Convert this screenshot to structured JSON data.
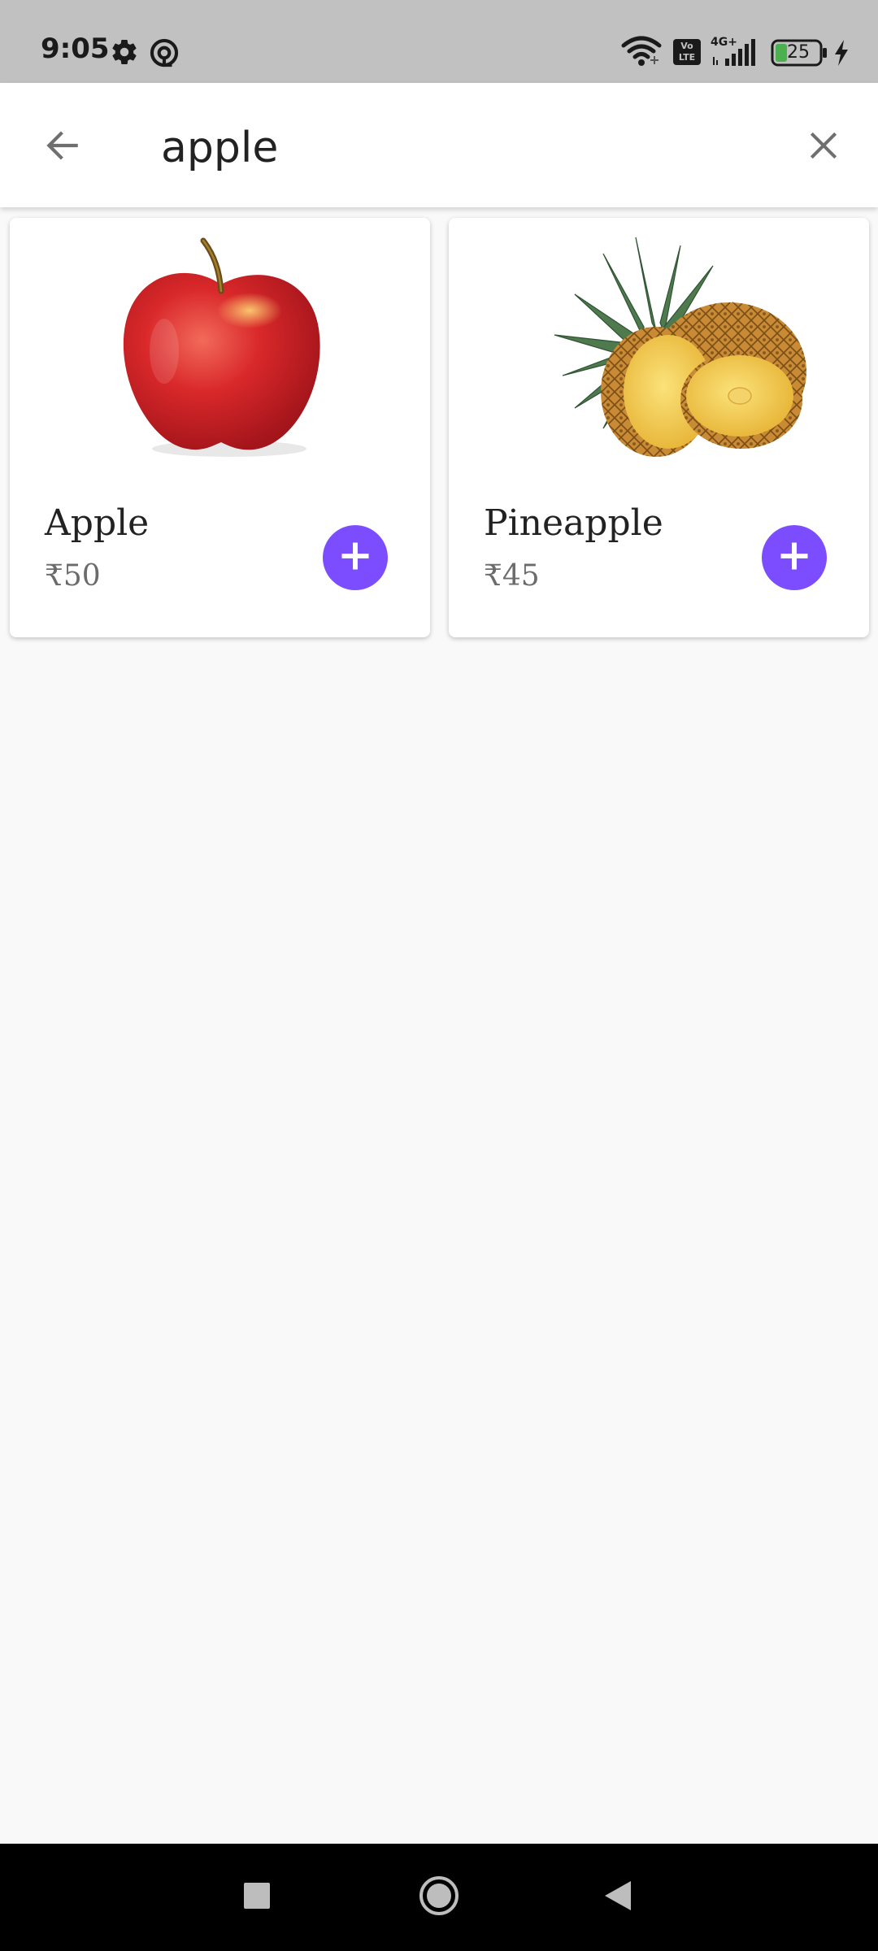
{
  "status_bar": {
    "time": "9:05",
    "battery_level": "25",
    "network_label": "4G+",
    "volte_label": "Vo LTE"
  },
  "search": {
    "query": "apple"
  },
  "results": [
    {
      "name": "Apple",
      "price": "₹50",
      "image_icon": "apple-image"
    },
    {
      "name": "Pineapple",
      "price": "₹45",
      "image_icon": "pineapple-image"
    }
  ],
  "colors": {
    "accent": "#7c4dff",
    "status_bar_bg": "#c1c1c1",
    "page_bg": "#f9f9f9",
    "nav_bar_bg": "#000000"
  }
}
